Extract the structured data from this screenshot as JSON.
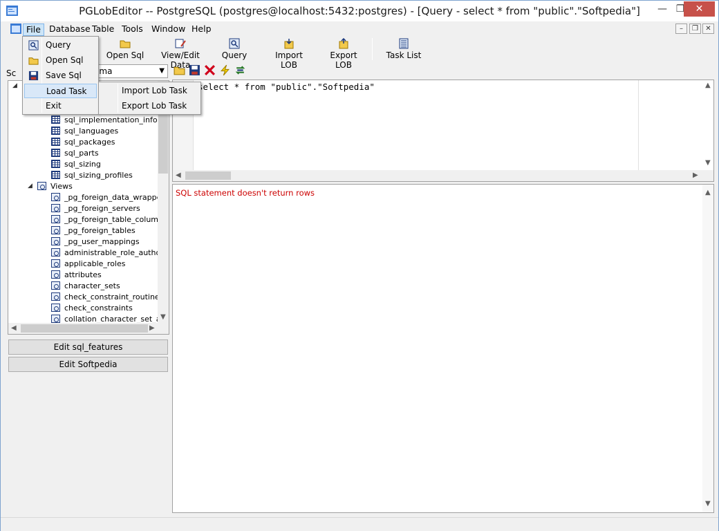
{
  "window": {
    "title": "PGLobEditor -- PostgreSQL (postgres@localhost:5432:postgres) - [Query - select * from \"public\".\"Softpedia\"]",
    "minimize": "—",
    "maximize": "❐",
    "close": "✕"
  },
  "menu": {
    "items": [
      "File",
      "Database",
      "Table",
      "Tools",
      "Window",
      "Help"
    ],
    "mdi_min": "–",
    "mdi_restore": "❐",
    "mdi_close": "✕"
  },
  "toolbar": {
    "items": [
      "Open Sql",
      "View/Edit Data",
      "Query",
      "Import LOB",
      "Export LOB",
      "Task List"
    ]
  },
  "left": {
    "schema_label": "Sc",
    "schema_value": "ema",
    "tree": {
      "tables": [
        "sql_implementation_info",
        "sql_languages",
        "sql_packages",
        "sql_parts",
        "sql_sizing",
        "sql_sizing_profiles"
      ],
      "views_label": "Views",
      "views": [
        "_pg_foreign_data_wrappers",
        "_pg_foreign_servers",
        "_pg_foreign_table_columns",
        "_pg_foreign_tables",
        "_pg_user_mappings",
        "administrable_role_authoriza",
        "applicable_roles",
        "attributes",
        "character_sets",
        "check_constraint_routine_us",
        "check_constraints",
        "collation_character_set_app"
      ]
    },
    "buttons": [
      "Edit sql_features",
      "Edit Softpedia"
    ]
  },
  "editor": {
    "code": "select * from \"public\".\"Softpedia\""
  },
  "result": {
    "message": "SQL statement doesn't return rows"
  },
  "file_menu": {
    "items": [
      "Query",
      "Open Sql",
      "Save Sql",
      "Load Task",
      "Exit"
    ],
    "submenu": [
      "Import Lob Task",
      "Export Lob Task"
    ]
  }
}
